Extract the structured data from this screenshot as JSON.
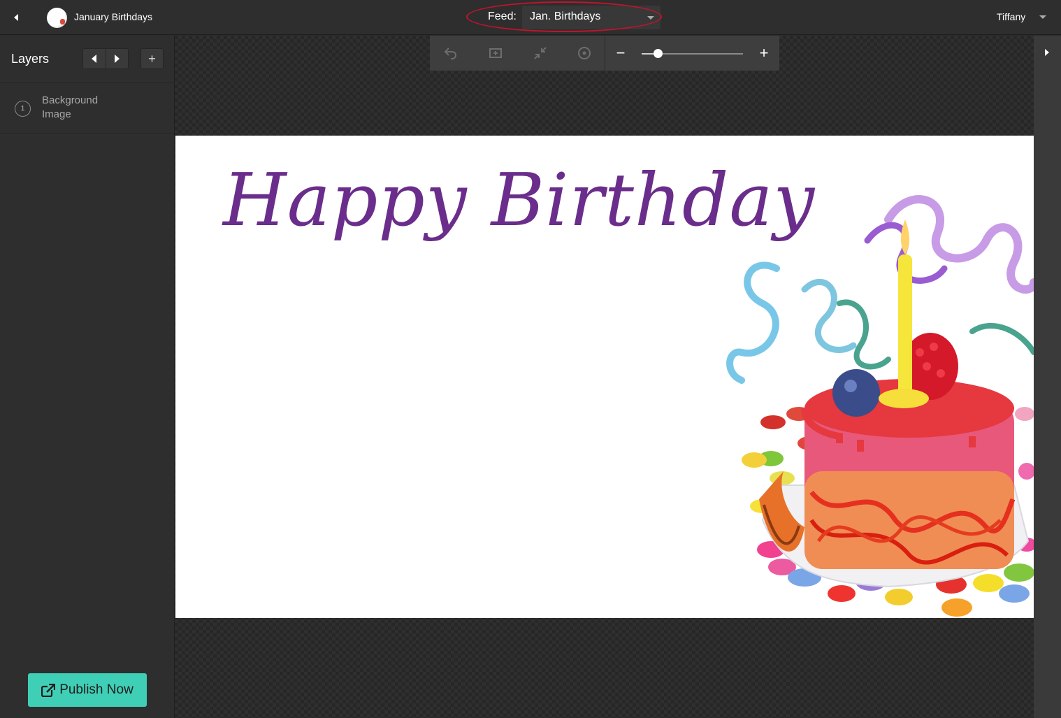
{
  "header": {
    "project_title": "January Birthdays",
    "feed_label": "Feed:",
    "feed_selected": "Jan. Birthdays",
    "user_name": "Tiffany"
  },
  "sidebar": {
    "title": "Layers",
    "add_symbol": "+",
    "layers": [
      {
        "number": "1",
        "label": "Background Image"
      }
    ],
    "publish_label": "Publish Now"
  },
  "toolbar": {
    "zoom_out_symbol": "−",
    "zoom_in_symbol": "+",
    "zoom_level": 0.16
  },
  "canvas": {
    "headline": "Happy Birthday",
    "headline_color": "#6b2d8b"
  },
  "colors": {
    "accent": "#3fcfb6",
    "highlight_ring": "#c0142b"
  }
}
